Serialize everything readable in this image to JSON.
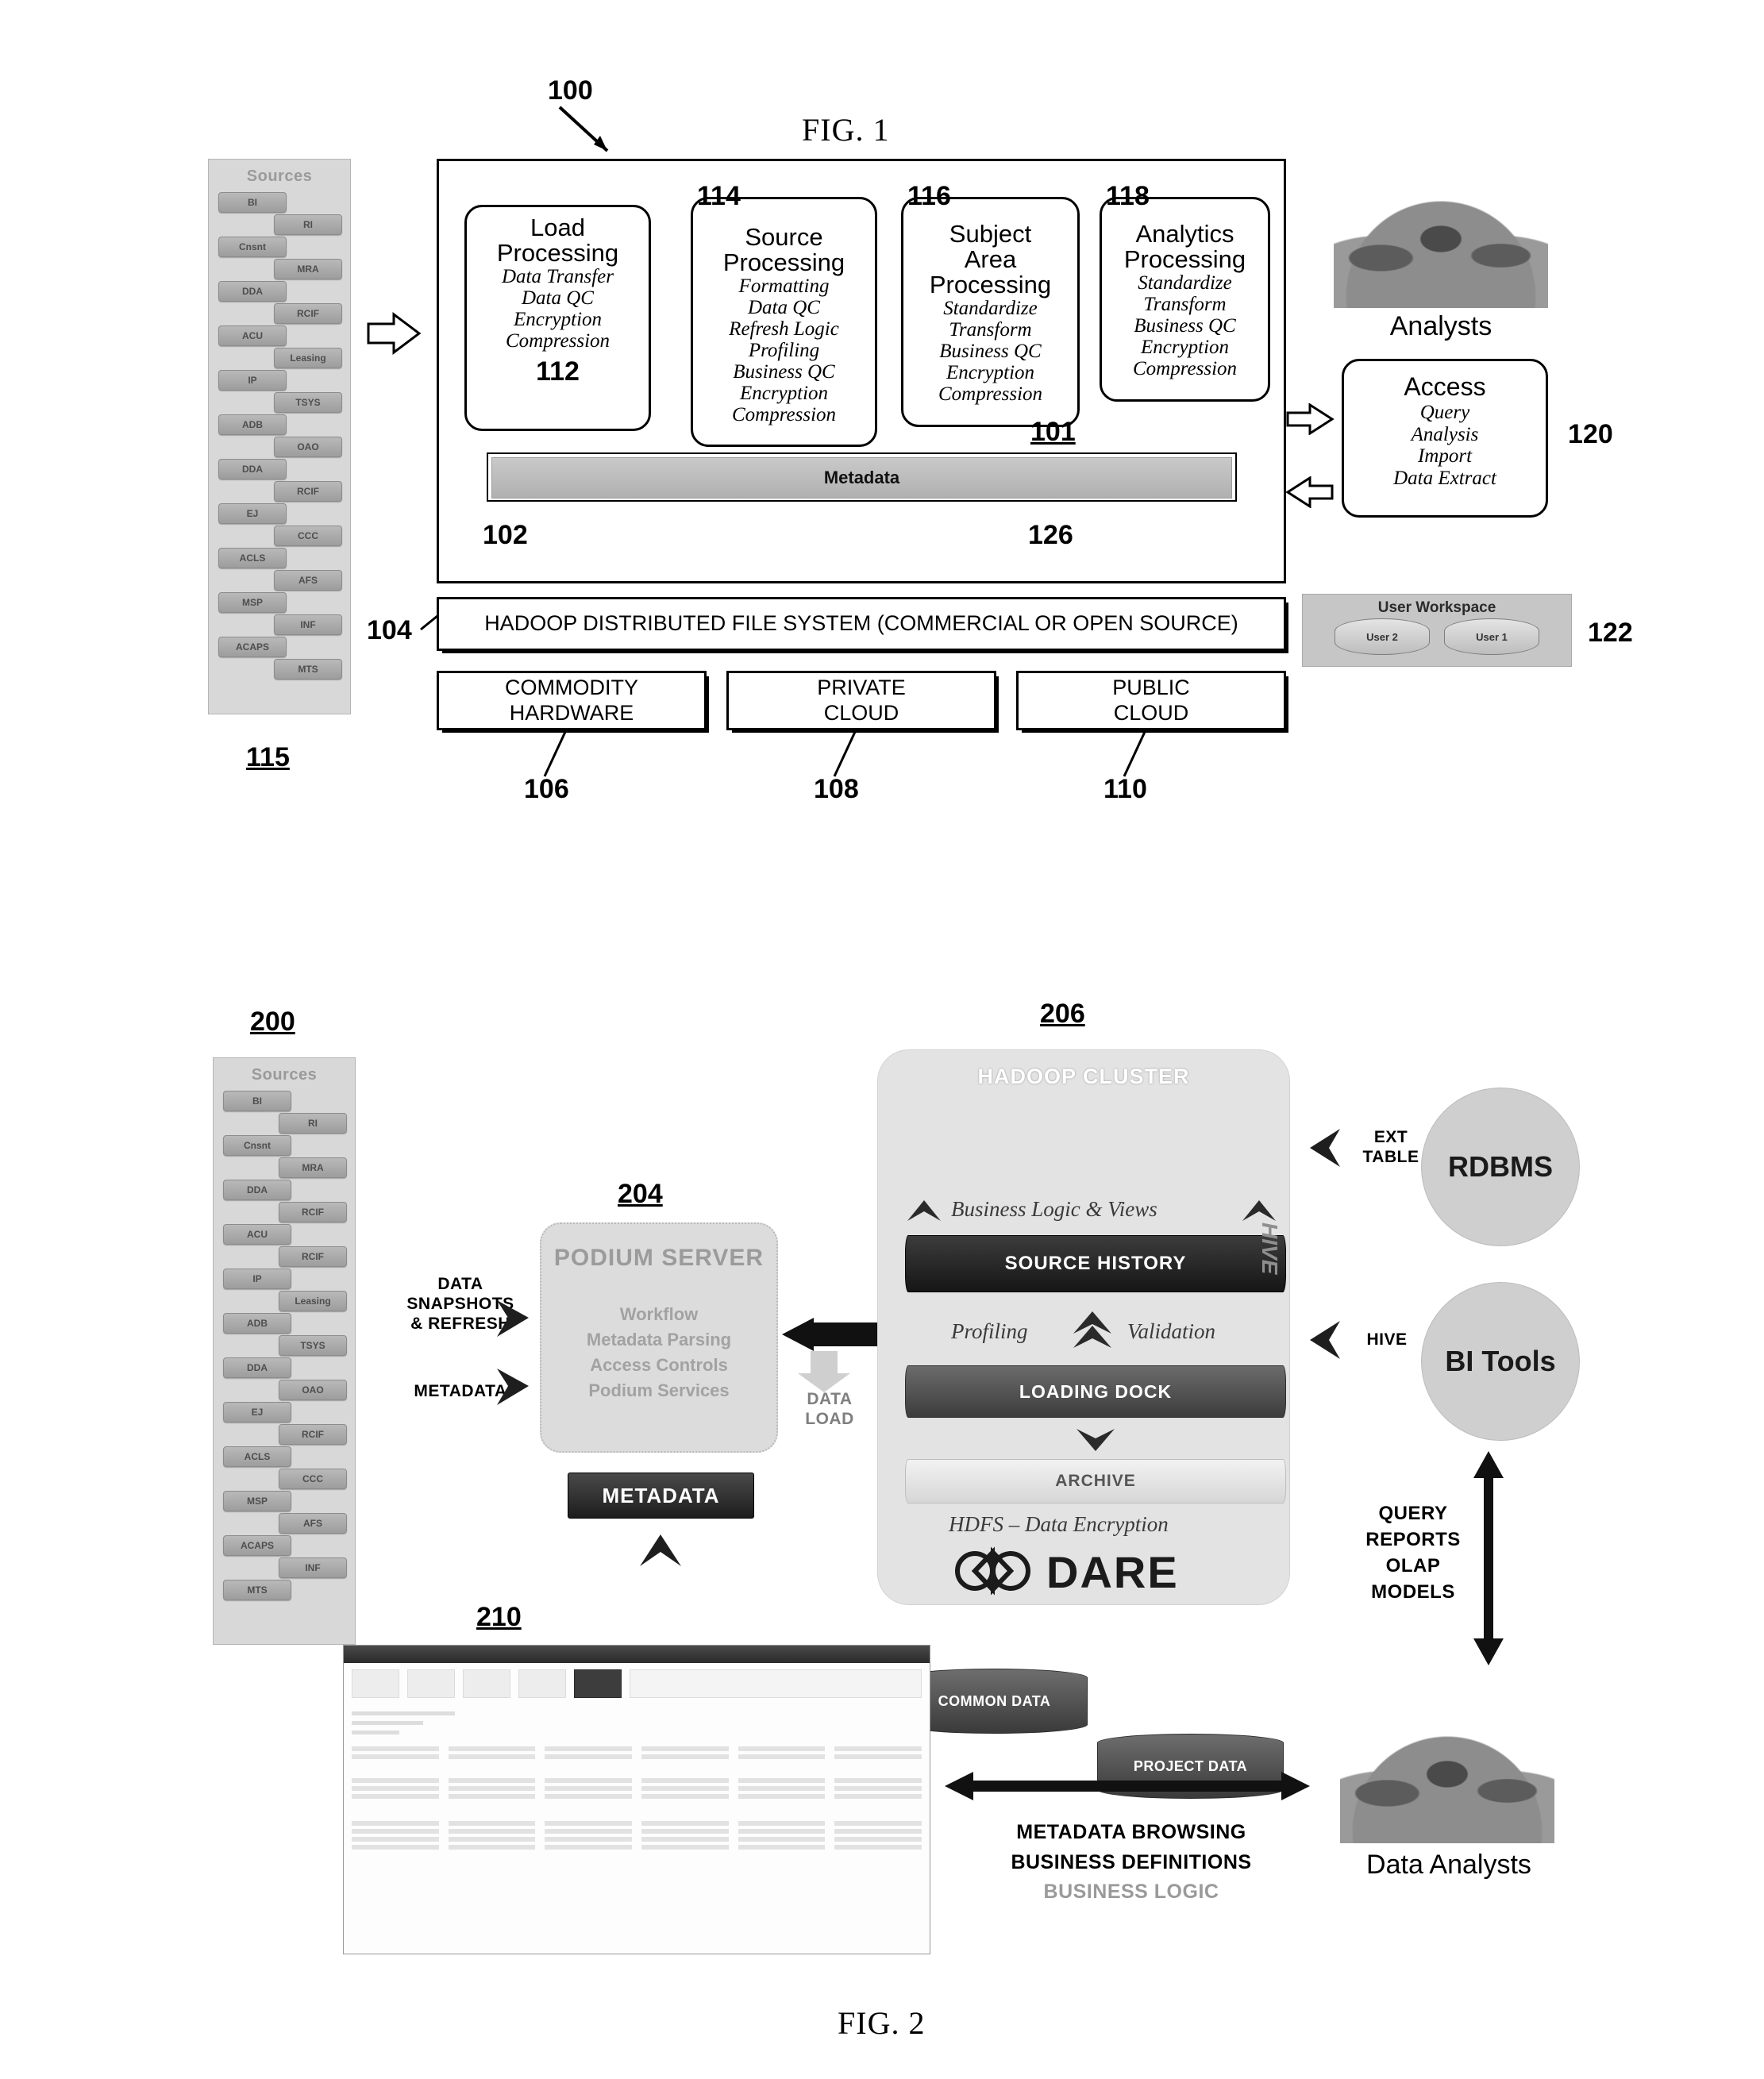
{
  "figures": {
    "fig1": {
      "title": "FIG. 1",
      "ref_system": "100",
      "sources": {
        "title": "Sources",
        "ref": "115",
        "chips": [
          "BI",
          "RI",
          "Cnsnt",
          "MRA",
          "DDA",
          "RCIF",
          "ACU",
          "Leasing",
          "IP",
          "TSYS",
          "ADB",
          "OAO",
          "DDA",
          "RCIF",
          "EJ",
          "CCC",
          "ACLS",
          "AFS",
          "MSP",
          "INF",
          "ACAPS",
          "MTS"
        ]
      },
      "container_ref": "101",
      "stages": [
        {
          "ref": "112",
          "ref_position": "bottom",
          "heading": [
            "Load",
            "Processing"
          ],
          "items": [
            "Data Transfer",
            "Data QC",
            "Encryption",
            "Compression"
          ]
        },
        {
          "ref": "114",
          "ref_position": "top",
          "heading": [
            "Source",
            "Processing"
          ],
          "items": [
            "Formatting",
            "Data QC",
            "Refresh Logic",
            "Profiling",
            "Business QC",
            "Encryption",
            "Compression"
          ]
        },
        {
          "ref": "116",
          "ref_position": "top",
          "heading": [
            "Subject",
            "Area",
            "Processing"
          ],
          "items": [
            "Standardize",
            "Transform",
            "Business QC",
            "Encryption",
            "Compression"
          ]
        },
        {
          "ref": "118",
          "ref_position": "top",
          "heading": [
            "Analytics",
            "Processing"
          ],
          "items": [
            "Standardize",
            "Transform",
            "Business QC",
            "Encryption",
            "Compression"
          ]
        }
      ],
      "metadata_bar": {
        "label": "Metadata",
        "ref_left": "102",
        "ref_right": "126"
      },
      "hdfs": {
        "label": "HADOOP DISTRIBUTED FILE SYSTEM (COMMERCIAL OR OPEN SOURCE)",
        "ref": "104"
      },
      "platforms": [
        {
          "lines": [
            "COMMODITY",
            "HARDWARE"
          ],
          "ref": "106"
        },
        {
          "lines": [
            "PRIVATE",
            "CLOUD"
          ],
          "ref": "108"
        },
        {
          "lines": [
            "PUBLIC",
            "CLOUD"
          ],
          "ref": "110"
        }
      ],
      "analysts_caption": "Analysts",
      "access": {
        "ref": "120",
        "heading": "Access",
        "items": [
          "Query",
          "Analysis",
          "Import",
          "Data Extract"
        ]
      },
      "workspace": {
        "ref": "122",
        "title": "User Workspace",
        "users": [
          "User 2",
          "User 1"
        ]
      }
    },
    "fig2": {
      "title": "FIG. 2",
      "ref_system": "200",
      "sources": {
        "title": "Sources",
        "chips": [
          "BI",
          "RI",
          "Cnsnt",
          "MRA",
          "DDA",
          "RCIF",
          "ACU",
          "RCIF",
          "IP",
          "Leasing",
          "ADB",
          "TSYS",
          "DDA",
          "OAO",
          "EJ",
          "RCIF",
          "ACLS",
          "CCC",
          "MSP",
          "AFS",
          "ACAPS",
          "INF",
          "MTS"
        ]
      },
      "flow_labels": {
        "data_snapshots": [
          "DATA",
          "SNAPSHOTS",
          "& REFRESH"
        ],
        "metadata": "METADATA",
        "data_load": [
          "DATA",
          "LOAD"
        ]
      },
      "podium": {
        "ref": "204",
        "title": "PODIUM SERVER",
        "items": [
          "Workflow",
          "Metadata Parsing",
          "Access Controls",
          "Podium Services"
        ]
      },
      "metadata_chip": "METADATA",
      "cluster": {
        "ref": "206",
        "title": "HADOOP CLUSTER",
        "databases": [
          "COMMON DATA",
          "PROJECT DATA"
        ],
        "business_logic": "Business Logic & Views",
        "source_history": "SOURCE HISTORY",
        "hive_label": "HIVE",
        "profiling": "Profiling",
        "validation": "Validation",
        "loading_dock": "LOADING DOCK",
        "archive": "ARCHIVE",
        "hdfs_note": "HDFS – Data Encryption",
        "brand": "DARE"
      },
      "right_nodes": [
        {
          "ext_label": [
            "EXT",
            "TABLE"
          ],
          "circle": "RDBMS"
        },
        {
          "ext_label": [
            "HIVE"
          ],
          "circle": "BI Tools"
        }
      ],
      "query_stack": [
        "QUERY",
        "REPORTS",
        "OLAP",
        "MODELS"
      ],
      "screenshot_ref": "210",
      "bottom_labels": [
        "METADATA BROWSING",
        "BUSINESS DEFINITIONS",
        "BUSINESS LOGIC"
      ],
      "analysts_caption": "Data Analysts"
    }
  }
}
